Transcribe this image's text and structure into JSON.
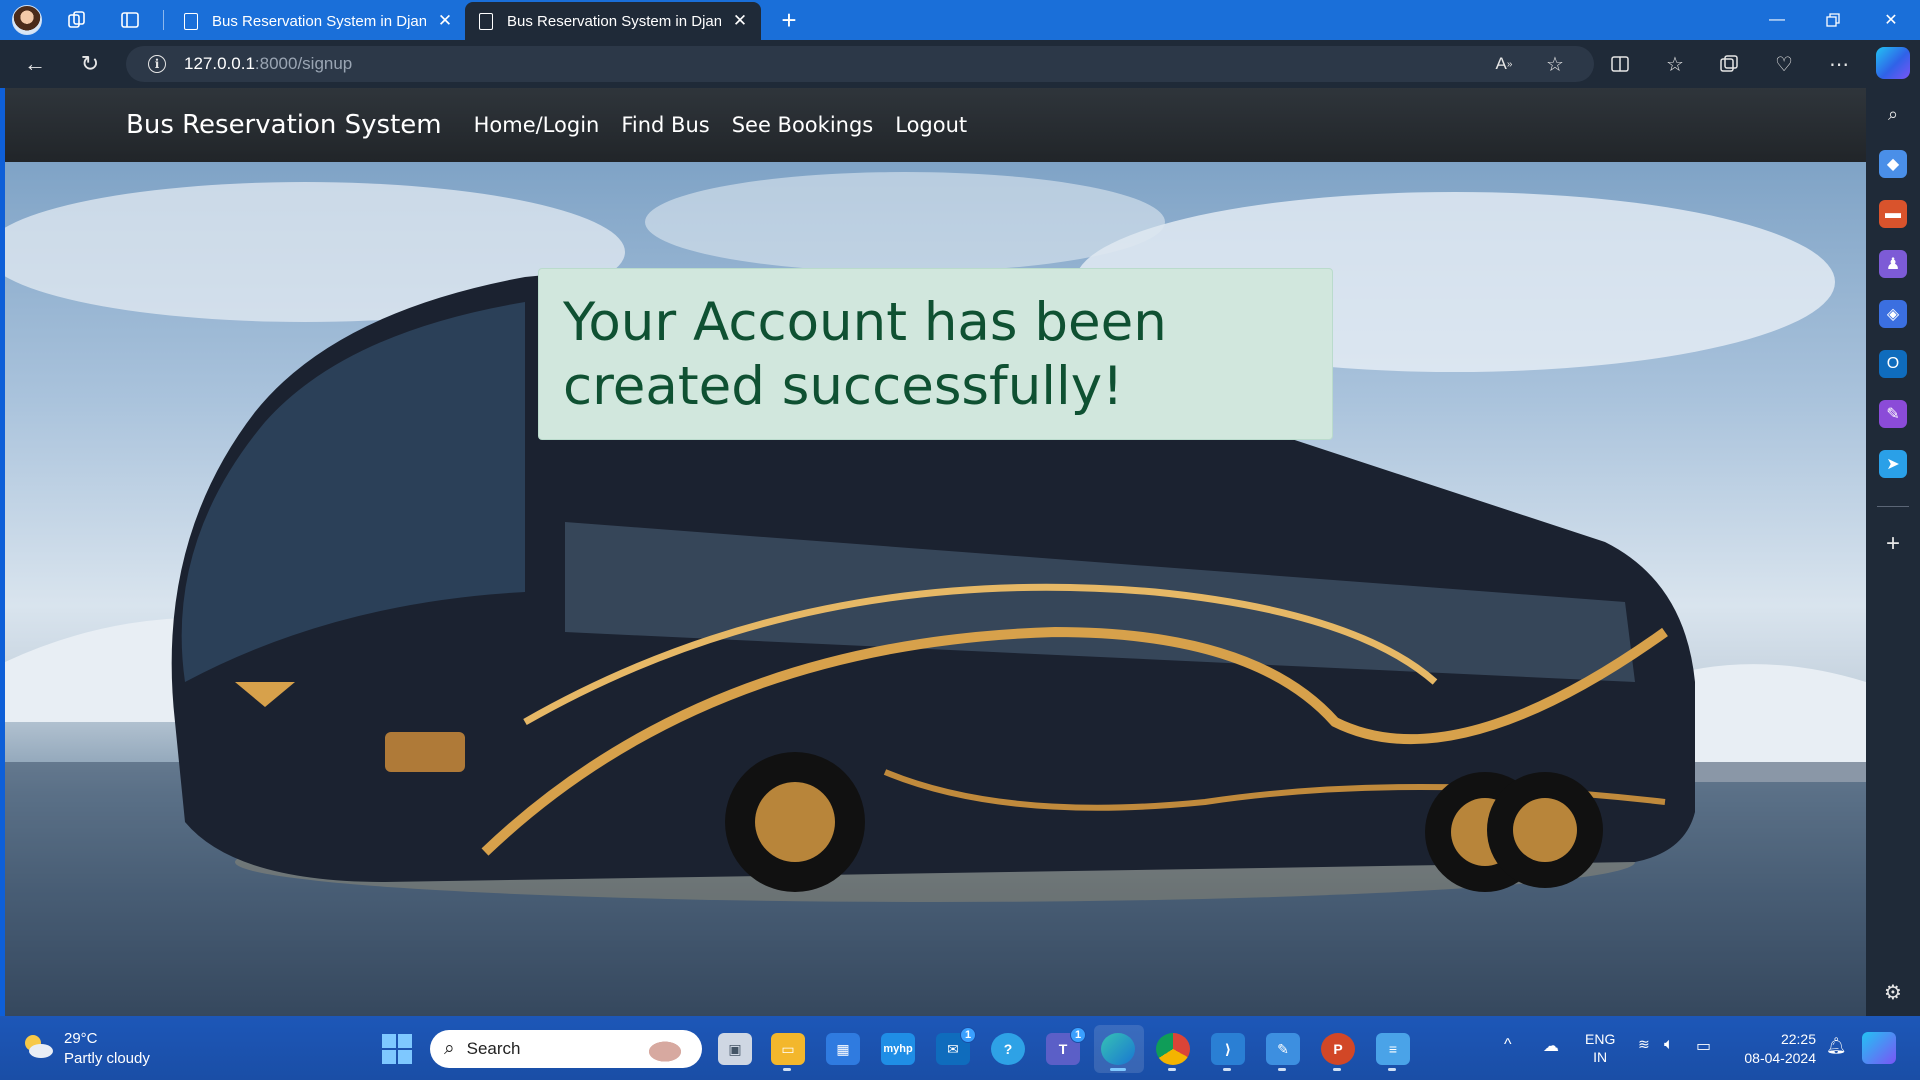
{
  "browser": {
    "tabs": [
      {
        "title": "Bus Reservation System in Django",
        "active": false
      },
      {
        "title": "Bus Reservation System in Django",
        "active": true
      }
    ],
    "address": {
      "host": "127.0.0.1",
      "path": ":8000/signup"
    }
  },
  "site": {
    "brand": "Bus Reservation System",
    "nav": [
      "Home/Login",
      "Find Bus",
      "See Bookings",
      "Logout"
    ],
    "alert": {
      "message": "Your Account has been created successfully!",
      "color": "#d1e7dd",
      "text_color": "#0f5132"
    }
  },
  "taskbar": {
    "weather": {
      "temp": "29°C",
      "desc": "Partly cloudy"
    },
    "search_placeholder": "Search",
    "badges": {
      "outlook": "1",
      "teams": "1"
    },
    "language": {
      "line1": "ENG",
      "line2": "IN"
    },
    "clock": {
      "time": "22:25",
      "date": "08-04-2024"
    }
  },
  "colors": {
    "titlebar": "#1a6fd9",
    "browser_chrome": "#1f2a38",
    "taskbar": "#1a4ea6"
  }
}
